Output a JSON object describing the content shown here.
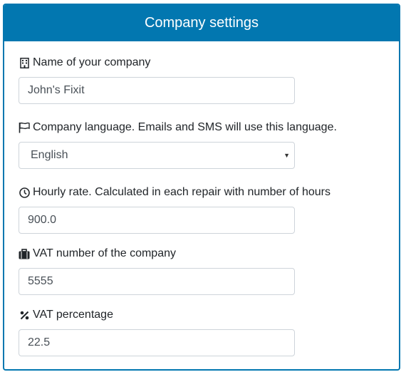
{
  "header": {
    "title": "Company settings"
  },
  "fields": {
    "company_name": {
      "label": "Name of your company",
      "value": "John's Fixit",
      "icon": "building-icon"
    },
    "language": {
      "label": "Company language. Emails and SMS will use this language.",
      "value": "English",
      "icon": "flag-icon"
    },
    "hourly_rate": {
      "label": "Hourly rate. Calculated in each repair with number of hours",
      "value": "900.0",
      "icon": "clock-icon"
    },
    "vat_number": {
      "label": "VAT number of the company",
      "value": "5555",
      "icon": "briefcase-icon"
    },
    "vat_percentage": {
      "label": "VAT percentage",
      "value": "22.5",
      "icon": "percent-icon"
    }
  },
  "colors": {
    "accent": "#0277b0",
    "border": "#ced4da"
  }
}
